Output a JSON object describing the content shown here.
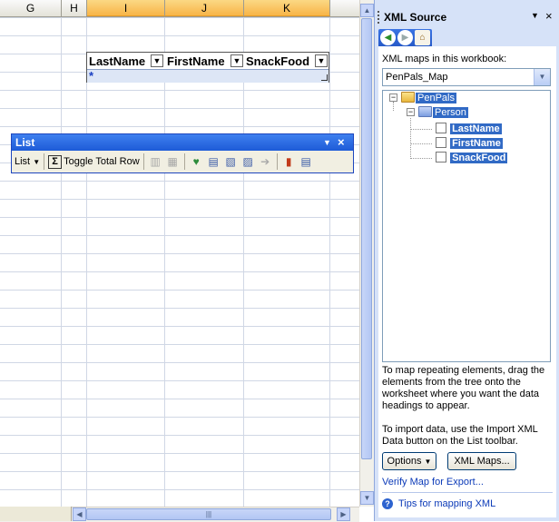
{
  "sheet": {
    "columns": [
      {
        "label": "G",
        "selected": false
      },
      {
        "label": "H",
        "selected": false
      },
      {
        "label": "I",
        "selected": true
      },
      {
        "label": "J",
        "selected": true
      },
      {
        "label": "K",
        "selected": true
      },
      {
        "label": "",
        "selected": false
      }
    ],
    "list": {
      "headers": [
        "LastName",
        "FirstName",
        "SnackFood"
      ],
      "insert_marker": "*"
    }
  },
  "list_toolbar": {
    "title": "List",
    "list_menu": "List",
    "toggle_total_row": "Toggle Total Row"
  },
  "pane": {
    "title": "XML Source",
    "maps_label": "XML maps in this workbook:",
    "selected_map": "PenPals_Map",
    "tree": {
      "root": "PenPals",
      "child": "Person",
      "fields": [
        "LastName",
        "FirstName",
        "SnackFood"
      ]
    },
    "help_mapping": "To map repeating elements, drag the elements from the tree onto the worksheet where you want the data headings to appear.",
    "help_import": "To import data, use the Import XML Data button on the List toolbar.",
    "options_button": "Options",
    "xml_maps_button": "XML Maps...",
    "verify_link": "Verify Map for Export...",
    "tips_link": "Tips for mapping XML"
  },
  "colors": {
    "accent": "#316ac5",
    "toolbar_title": "#1d5bd7",
    "pane_bg": "#d6e2f8"
  }
}
